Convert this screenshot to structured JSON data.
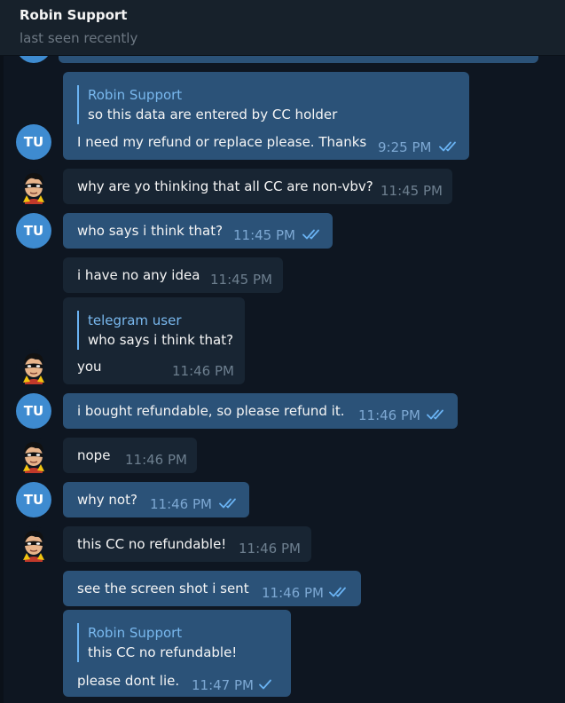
{
  "header": {
    "title": "Robin Support",
    "status": "last seen recently"
  },
  "avatars": {
    "user_initials": "TU",
    "support_icon": "robin-mask-avatar"
  },
  "messages": [
    {
      "direction": "out",
      "reply_name": "Robin Support",
      "reply_text": "so this data are entered by CC holder",
      "text": "I need my refund or replace please. Thanks",
      "time": "9:25 PM",
      "status": "read"
    },
    {
      "direction": "in",
      "text": "why are yo thinking that all CC are non-vbv?",
      "time": "11:45 PM"
    },
    {
      "direction": "out",
      "text": "who says i think that?",
      "time": "11:45 PM",
      "status": "read"
    },
    {
      "direction": "in",
      "text": "i have no any idea",
      "time": "11:45 PM"
    },
    {
      "direction": "in",
      "reply_name": "telegram user",
      "reply_text": "who says i think that?",
      "text": "you",
      "time": "11:46 PM"
    },
    {
      "direction": "out",
      "text": "i bought refundable, so please refund it.",
      "time": "11:46 PM",
      "status": "read"
    },
    {
      "direction": "in",
      "text": "nope",
      "time": "11:46 PM"
    },
    {
      "direction": "out",
      "text": "why not?",
      "time": "11:46 PM",
      "status": "read"
    },
    {
      "direction": "in",
      "text": "this CC no refundable!",
      "time": "11:46 PM"
    },
    {
      "direction": "out",
      "text": "see the screen shot i sent",
      "time": "11:46 PM",
      "status": "read"
    },
    {
      "direction": "out",
      "reply_name": "Robin Support",
      "reply_text": "this CC no refundable!",
      "text": "please dont lie.",
      "time": "11:47 PM",
      "status": "sent"
    }
  ],
  "colors": {
    "background": "#0e1621",
    "header": "#17212b",
    "outgoing_bubble": "#2b5278",
    "incoming_bubble": "#182533",
    "accent": "#6ab3f3",
    "avatar_tu": "#3e8bd0"
  }
}
